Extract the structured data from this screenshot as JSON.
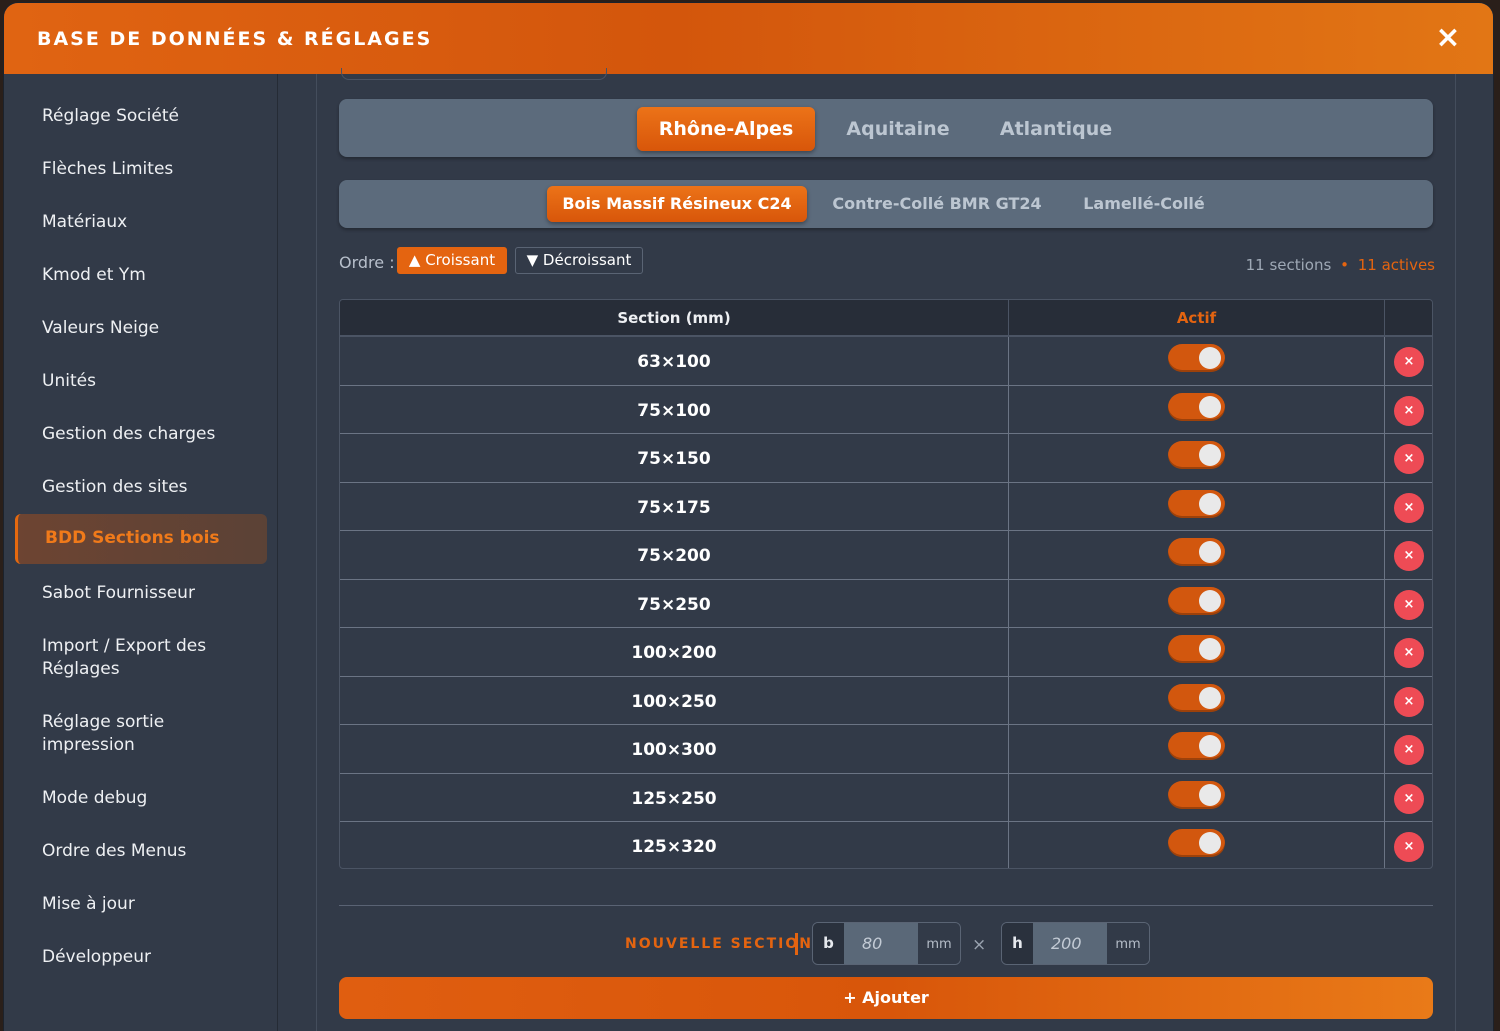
{
  "header": {
    "title": "BASE DE DONNÉES & RÉGLAGES",
    "close_icon": "close-icon"
  },
  "sidebar": {
    "items": [
      {
        "label": "Réglage Société"
      },
      {
        "label": "Flèches Limites"
      },
      {
        "label": "Matériaux"
      },
      {
        "label": "Kmod et Ym"
      },
      {
        "label": "Valeurs Neige"
      },
      {
        "label": "Unités"
      },
      {
        "label": "Gestion des charges"
      },
      {
        "label": "Gestion des sites"
      },
      {
        "label": "BDD Sections bois",
        "active": true
      },
      {
        "label": "Sabot Fournisseur"
      },
      {
        "label": "Import / Export des Réglages"
      },
      {
        "label": "Réglage sortie impression"
      },
      {
        "label": "Mode debug"
      },
      {
        "label": "Ordre des Menus"
      },
      {
        "label": "Mise à jour"
      },
      {
        "label": "Développeur"
      }
    ]
  },
  "region_tabs": {
    "items": [
      {
        "label": "Rhône-Alpes",
        "active": true
      },
      {
        "label": "Aquitaine"
      },
      {
        "label": "Atlantique"
      }
    ]
  },
  "material_tabs": {
    "items": [
      {
        "label": "Bois Massif Résineux C24",
        "active": true
      },
      {
        "label": "Contre-Collé BMR GT24"
      },
      {
        "label": "Lamellé-Collé"
      }
    ]
  },
  "order": {
    "label": "Ordre :",
    "asc_label": "▲ Croissant",
    "desc_label": "▼ Décroissant",
    "selected": "asc"
  },
  "counts": {
    "sections": "11 sections",
    "separator": "•",
    "actives": "11 actives"
  },
  "table": {
    "headers": {
      "section": "Section (mm)",
      "active": "Actif"
    },
    "delete_icon": "×",
    "rows": [
      {
        "section": "63×100",
        "active": true
      },
      {
        "section": "75×100",
        "active": true
      },
      {
        "section": "75×150",
        "active": true
      },
      {
        "section": "75×175",
        "active": true
      },
      {
        "section": "75×200",
        "active": true
      },
      {
        "section": "75×250",
        "active": true
      },
      {
        "section": "100×200",
        "active": true
      },
      {
        "section": "100×250",
        "active": true
      },
      {
        "section": "100×300",
        "active": true
      },
      {
        "section": "125×250",
        "active": true
      },
      {
        "section": "125×320",
        "active": true
      }
    ]
  },
  "new_section": {
    "label": "NOUVELLE SECTION",
    "b": {
      "prefix": "b",
      "placeholder": "80",
      "unit": "mm"
    },
    "times": "×",
    "h": {
      "prefix": "h",
      "placeholder": "200",
      "unit": "mm"
    },
    "add_label": "+ Ajouter"
  },
  "colors": {
    "accent": "#e46410",
    "panel": "#323a48",
    "delete": "#ee4b55"
  }
}
